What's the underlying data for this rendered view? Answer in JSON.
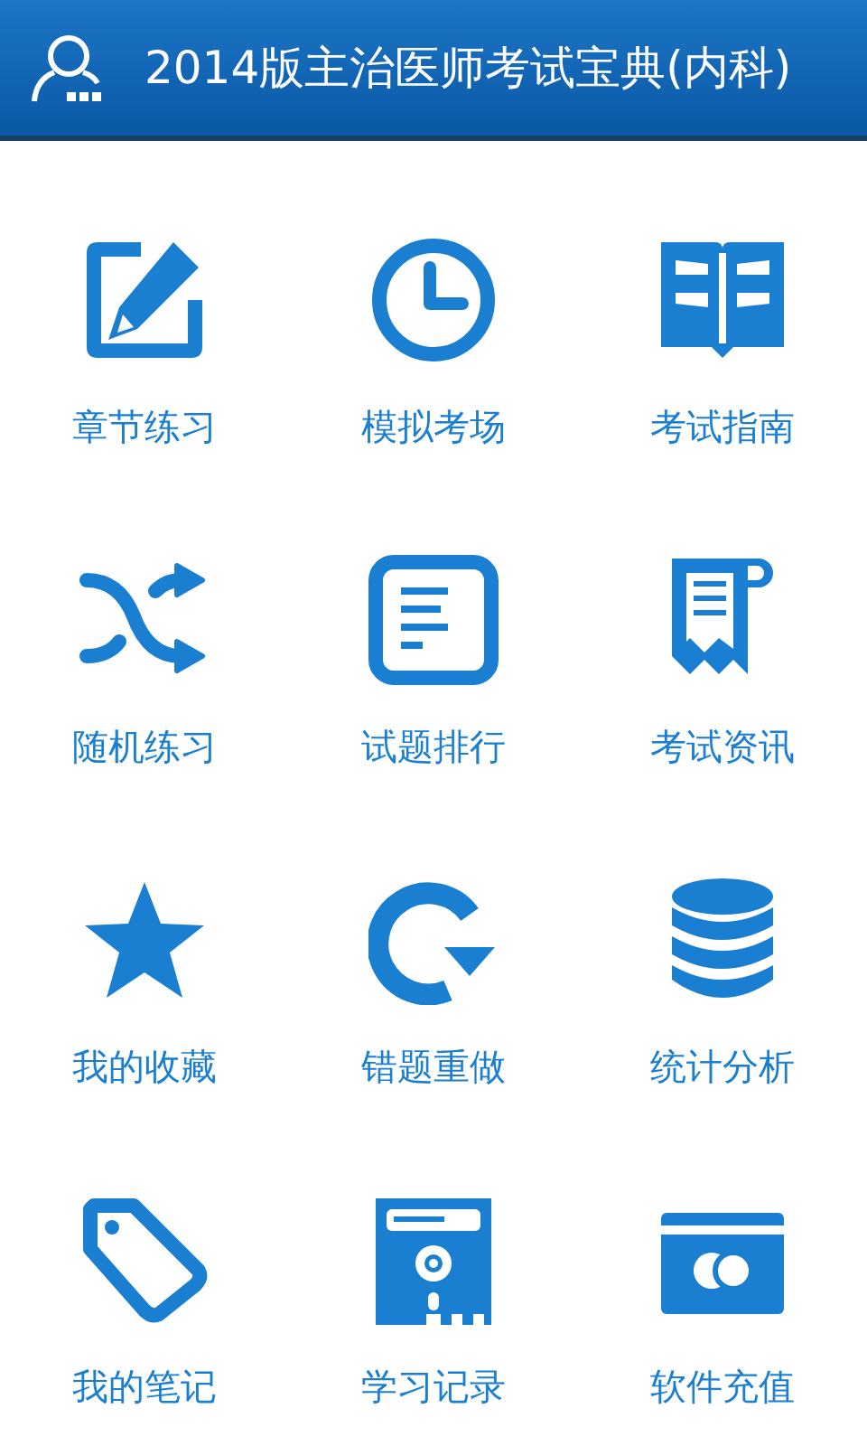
{
  "header": {
    "title": "2014版主治医师考试宝典(内科)"
  },
  "menu": [
    {
      "label": "章节练习"
    },
    {
      "label": "模拟考场"
    },
    {
      "label": "考试指南"
    },
    {
      "label": "随机练习"
    },
    {
      "label": "试题排行"
    },
    {
      "label": "考试资讯"
    },
    {
      "label": "我的收藏"
    },
    {
      "label": "错题重做"
    },
    {
      "label": "统计分析"
    },
    {
      "label": "我的笔记"
    },
    {
      "label": "学习记录"
    },
    {
      "label": "软件充值"
    }
  ]
}
